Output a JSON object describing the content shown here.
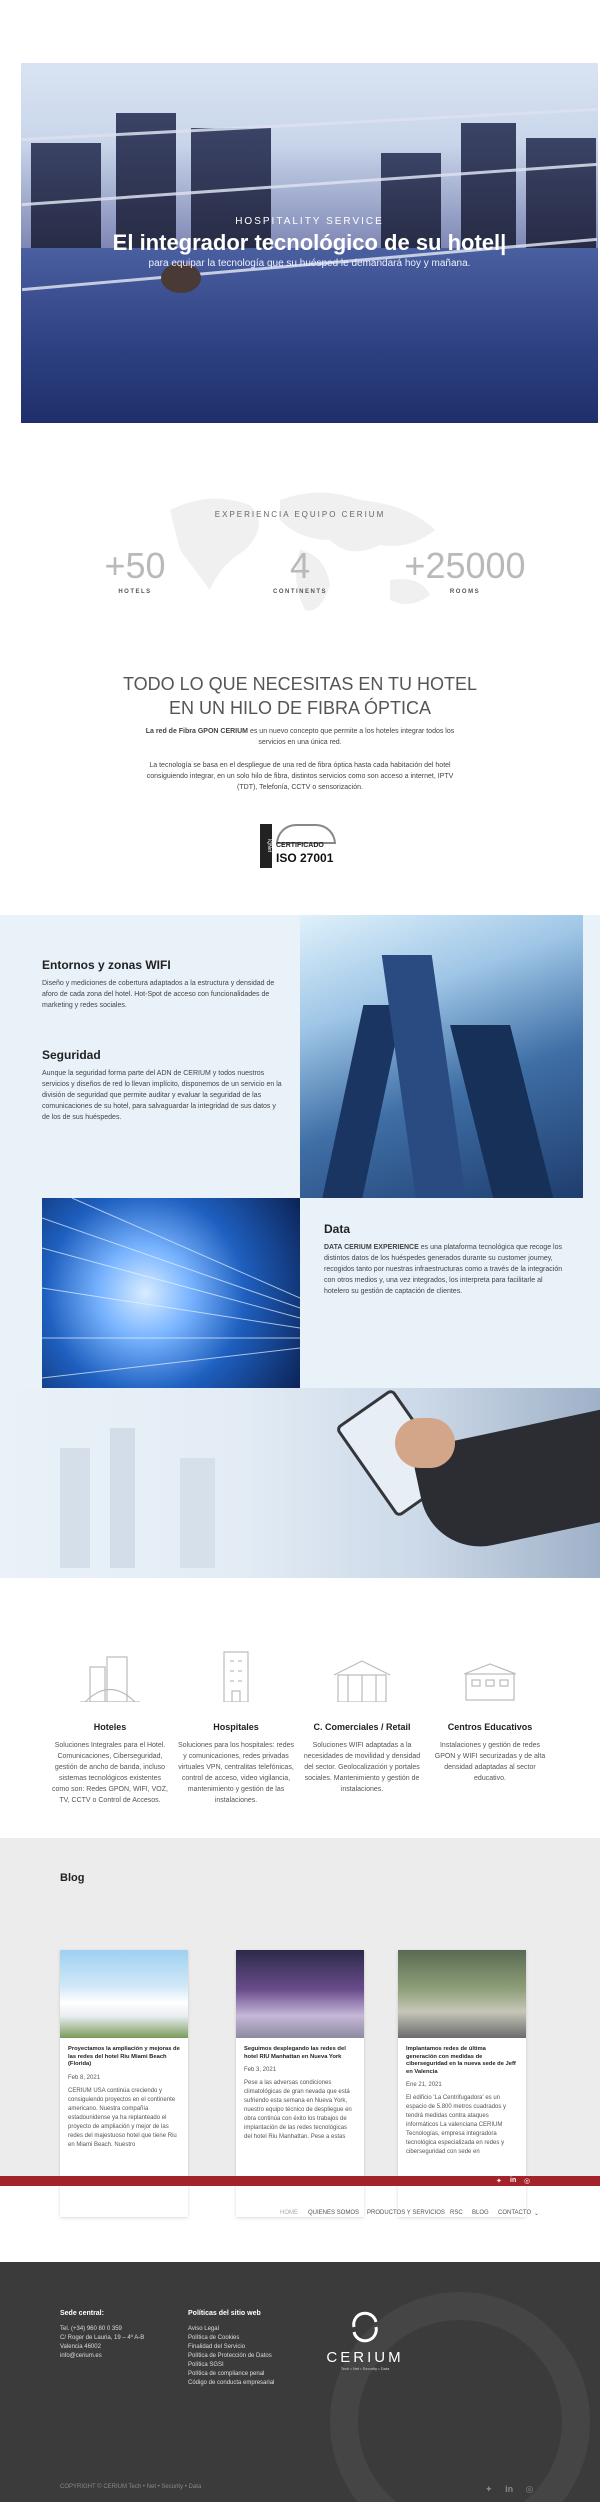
{
  "hero": {
    "kicker": "HOSPITALITY SERVICE",
    "title": "El integrador tecnológico de su hotel|",
    "subtitle": "para equipar la tecnología que su huésped le demandará hoy y mañana."
  },
  "experience": {
    "label": "EXPERIENCIA EQUIPO CERIUM",
    "stats": [
      {
        "value": "+50",
        "label": "HOTELS"
      },
      {
        "value": "4",
        "label": "CONTINENTS"
      },
      {
        "value": "+25000",
        "label": "ROOMS"
      }
    ]
  },
  "fibra": {
    "title_line1": "TODO LO QUE NECESITAS EN TU HOTEL",
    "title_line2": "EN UN HILO DE FIBRA ÓPTICA",
    "p1_bold": "La red de Fibra GPON CERIUM",
    "p1_rest": " es un nuevo concepto que permite a los hoteles integrar todos los servicios en una única red.",
    "p2": "La tecnología se basa en el despliegue de una red de fibra óptica hasta cada habitación del hotel consiguiendo integrar, en un solo hilo de fibra, distintos servicios como son acceso a internet, IPTV (TDT), Telefonía, CCTV o sensorización.",
    "iso_top": "CERTIFICADO",
    "iso_num": "ISO 27001",
    "iso_side": "IQNet"
  },
  "features": {
    "wifi": {
      "title": "Entornos y zonas WIFI",
      "text": "Diseño y mediciones de cobertura adaptados a la estructura y densidad de aforo de cada zona del hotel. Hot-Spot de acceso con funcionalidades de marketing y redes sociales."
    },
    "seguridad": {
      "title": "Seguridad",
      "text": "Aunque la seguridad forma parte del ADN de CERIUM y todos nuestros servicios y diseños de red lo llevan implícito, disponemos de un servicio en la división de seguridad que permite auditar y evaluar la seguridad de las comunicaciones de su hotel, para salvaguardar la integridad de sus datos y de los de sus huéspedes."
    },
    "data": {
      "title": "Data",
      "bold": "DATA CERIUM EXPERIENCE",
      "text": " es una plataforma tecnológica que recoge los distintos datos de los huéspedes generados durante su customer journey, recogidos tanto por nuestras infraestructuras como a través de la integración con otros medios y, una vez integrados, los interpreta para facilitarle al hotelero su gestión de captación de clientes."
    }
  },
  "sectors": [
    {
      "title": "Hoteles",
      "text": "Soluciones Integrales para el Hotel. Comunicaciones, Ciberseguridad, gestión de ancho de banda, incluso sistemas tecnológicos existentes como son: Redes GPON, WIFI, VOZ, TV, CCTV o Control de Accesos.",
      "icon": "hotel-icon"
    },
    {
      "title": "Hospitales",
      "text": "Soluciones para los hospitales: redes y comunicaciones, redes privadas virtuales VPN, centralitas telefónicas, control de acceso, video vigilancia, mantenimiento y gestión de las instalaciones.",
      "icon": "hospital-icon"
    },
    {
      "title": "C. Comerciales / Retail",
      "text": "Soluciones WIFI adaptadas a la necesidades de movilidad y densidad del sector. Geolocalización y portales sociales. Mantenimiento y gestión de instalaciones.",
      "icon": "mall-icon"
    },
    {
      "title": "Centros Educativos",
      "text": "Instalaciones y gestión de redes GPON y WIFI securizadas y de alta densidad adaptadas al sector educativo.",
      "icon": "school-icon"
    }
  ],
  "blog": {
    "title": "Blog",
    "posts": [
      {
        "title": "Proyectamos la ampliación y mejoras de las redes del hotel Riu Miami Beach (Florida)",
        "date": "Feb 8, 2021",
        "excerpt": "CERIUM USA continúa creciendo y consiguiendo proyectos en el continente americano. Nuestra compañía estadounidense ya ha replanteado el proyecto de ampliación y mejor de las redes del majestuoso hotel que tiene Riu en Miami Beach. Nuestro"
      },
      {
        "title": "Seguimos desplegando las redes del hotel RIU Manhattan en Nueva York",
        "date": "Feb 3, 2021",
        "excerpt": "Pese a las adversas condiciones climatológicas de gran nevada que está sufriendo esta semana en Nueva York, nuestro equipo técnico de despliegue en obra continúa con éxito los trabajos de implantación de las redes tecnológicas del hotel Riu Manhattan. Pese a estas"
      },
      {
        "title": "Implantamos redes de última generación con medidas de ciberseguridad en la nueva sede de Jeff en Valencia",
        "date": "Ene 21, 2021",
        "excerpt": "El edificio 'La Centrifugadora' es un espacio de 5.800 metros cuadrados y tendrá medidas contra ataques informáticos La valenciana CERIUM Tecnologías, empresa integradora tecnológica especializada en redes y ciberseguridad con sede en"
      }
    ]
  },
  "nav": {
    "items": [
      "HOME",
      "QUIENES SOMOS",
      "PRODUCTOS Y SERVICIOS",
      "RSC",
      "BLOG",
      "CONTACTO"
    ]
  },
  "footer": {
    "sede_title": "Sede central:",
    "sede_items": [
      "Tel. (+34) 960 80 0 359",
      "C/ Roger de Lauria, 19 – 4º A-B",
      "Valencia 46002",
      "info@cerium.es"
    ],
    "politicas_title": "Políticas del sitio web",
    "politicas_items": [
      "Aviso Legal",
      "Política de Cookies",
      "Finalidad del Servicio",
      "Política de Protección de Datos",
      "Política SGSI",
      "Política de compliance penal",
      "Código de conducta empresarial"
    ],
    "logo_text": "CERIUM",
    "logo_sub": "Tech • Net • Security • Data",
    "copyright": "COPYRIGHT © CERIUM Tech • Net • Security • Data"
  },
  "colors": {
    "accent_red": "#a3232a",
    "footer_bg": "#3b3b3b",
    "feature_bg": "#e9f2f8",
    "blog_bg": "#ececec"
  }
}
